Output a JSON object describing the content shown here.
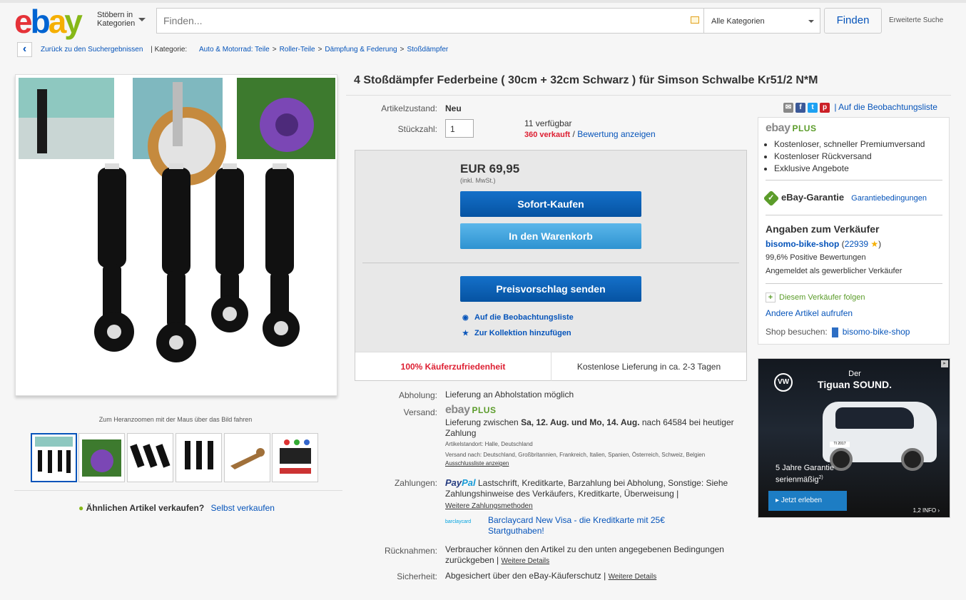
{
  "header": {
    "logo_letters": [
      "e",
      "b",
      "a",
      "y"
    ],
    "browse_line1": "Stöbern in",
    "browse_line2": "Kategorien",
    "search_placeholder": "Finden...",
    "category": "Alle Kategorien",
    "find_button": "Finden",
    "advanced_search": "Erweiterte Suche"
  },
  "breadcrumb": {
    "back_link": "Zurück zu den Suchergebnissen",
    "category_label": "| Kategorie:",
    "items": [
      "Auto & Motorrad: Teile",
      "Roller-Teile",
      "Dämpfung & Federung",
      "Stoßdämpfer"
    ],
    "separator": ">"
  },
  "gallery": {
    "zoom_hint": "Zum Heranzoomen mit der Maus über das Bild fahren",
    "thumb_count": 6
  },
  "sell_similar": {
    "question": "Ähnlichen Artikel verkaufen?",
    "link": "Selbst verkaufen"
  },
  "item": {
    "title": "4 Stoßdämpfer Federbeine ( 30cm + 32cm Schwarz ) für Simson Schwalbe Kr51/2 N*M",
    "condition_label": "Artikelzustand:",
    "condition_value": "Neu",
    "quantity_label": "Stückzahl:",
    "quantity_value": "1",
    "available": "11 verfügbar",
    "sold": "360 verkauft",
    "sold_sep": " / ",
    "review_link": "Bewertung anzeigen"
  },
  "buybox": {
    "price": "EUR 69,95",
    "tax_note": "(inkl. MwSt.)",
    "buy_now": "Sofort-Kaufen",
    "add_cart": "In den Warenkorb",
    "offer": "Preisvorschlag senden",
    "watch": "Auf die Beobachtungsliste",
    "collection": "Zur Kollektion hinzufügen",
    "satisfaction": "100% Käuferzufriedenheit",
    "delivery": "Kostenlose Lieferung in ca. 2-3 Tagen"
  },
  "details": {
    "pickup_label": "Abholung:",
    "pickup_value": "Lieferung an Abholstation möglich",
    "shipping_label": "Versand:",
    "shipping_plus_e": "ebay",
    "shipping_plus_p": "PLUS",
    "shipping_pre": "Lieferung zwischen ",
    "shipping_dates": "Sa, 12. Aug. und Mo, 14. Aug.",
    "shipping_post": " nach 64584 bei heutiger Zahlung",
    "item_location": "Artikelstandort:  Halle, Deutschland",
    "ships_to": "Versand nach:  Deutschland, Großbritannien, Frankreich, Italien, Spanien, Österreich, Schweiz, Belgien",
    "exclusion_link": "Ausschlussliste anzeigen",
    "payment_label": "Zahlungen:",
    "paypal_a": "Pay",
    "paypal_b": "Pal",
    "payment_methods": " Lastschrift,  Kreditkarte,  Barzahlung bei Abholung,  Sonstige: Siehe Zahlungshinweise des Verkäufers,  Kreditkarte,  Überweisung  |",
    "payment_more": "Weitere Zahlungsmethoden",
    "barclay_logo": "barclaycard",
    "barclay_offer": "Barclaycard New Visa - die Kreditkarte mit 25€ Startguthaben!",
    "returns_label": "Rücknahmen:",
    "returns_value": "Verbraucher können den Artikel zu den unten angegebenen Bedingungen zurückgeben |",
    "more_details": "Weitere Details",
    "security_label": "Sicherheit:",
    "security_value": "Abgesichert über den eBay-Käuferschutz  |"
  },
  "share": {
    "watchlist": "| Auf die Beobachtungsliste",
    "fb": "f",
    "tw": "t",
    "pin": "p"
  },
  "side": {
    "plus_e": "ebay",
    "plus_p": "PLUS",
    "benefits": [
      "Kostenloser, schneller Premiumversand",
      "Kostenloser Rückversand",
      "Exklusive Angebote"
    ],
    "guarantee": "eBay-Garantie",
    "guarantee_link": "Garantiebedingungen",
    "seller_heading": "Angaben zum Verkäufer",
    "seller_name": "bisomo-bike-shop",
    "seller_score": "22939",
    "positive": "99,6% Positive Bewertungen",
    "business": "Angemeldet als gewerblicher Verkäufer",
    "follow": "Diesem Verkäufer folgen",
    "other_items": "Andere Artikel aufrufen",
    "shop_label": "Shop besuchen:",
    "shop_name": "bisomo-bike-shop"
  },
  "ad": {
    "brand": "VW",
    "pre": "Der",
    "title": "Tiguan SOUND.",
    "guarantee_l1": "5 Jahre Garantie",
    "guarantee_l2": "serienmäßig",
    "guarantee_sup": "2)",
    "cta": "Jetzt erleben",
    "info": "1,2 INFO",
    "plate": "TI 2017"
  },
  "colors": {
    "link": "#0654ba",
    "button_dark": "#0653a2",
    "button_light": "#2e93d1",
    "red": "#dd1e31",
    "green": "#5b9c2a"
  }
}
